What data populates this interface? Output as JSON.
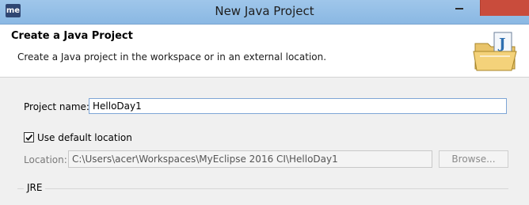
{
  "window": {
    "app_logo_text": "me",
    "title": "New Java Project"
  },
  "banner": {
    "title": "Create a Java Project",
    "description": "Create a Java project in the workspace or in an external location.",
    "icon": "java-project-folder-icon"
  },
  "form": {
    "project_name_label": "Project name:",
    "project_name_value": "HelloDay1",
    "use_default_location_label": "Use default location",
    "use_default_location_checked": true,
    "location_label": "Location:",
    "location_value": "C:\\Users\\acer\\Workspaces\\MyEclipse 2016 CI\\HelloDay1",
    "browse_label": "Browse...",
    "jre_group_label": "JRE"
  }
}
